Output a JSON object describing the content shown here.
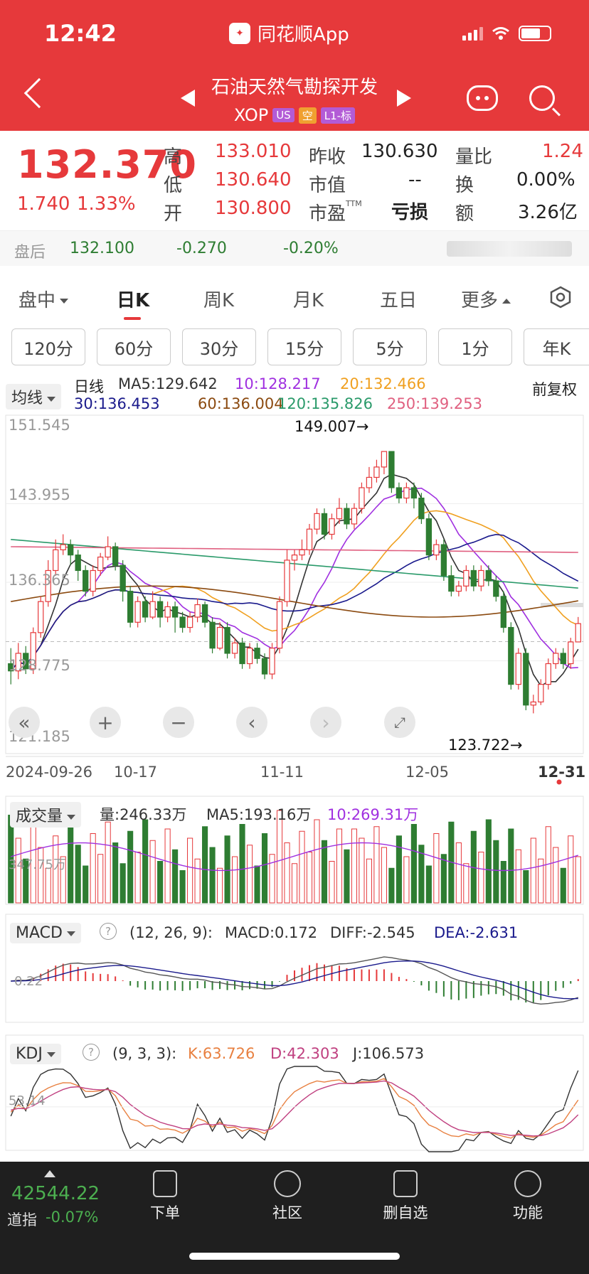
{
  "status_bar": {
    "time": "12:42",
    "app_name": "同花顺App"
  },
  "header": {
    "stock_name": "石油天然气勘探开发",
    "code": "XOP",
    "tags": [
      "US",
      "空",
      "L1-标"
    ]
  },
  "quote": {
    "price": "132.370",
    "change": "1.740",
    "change_pct": "1.33%",
    "high_label": "高",
    "high": "133.010",
    "low_label": "低",
    "low": "130.640",
    "open_label": "开",
    "open": "130.800",
    "prev_close_label": "昨收",
    "prev_close": "130.630",
    "market_cap_label": "市值",
    "market_cap": "--",
    "pe_label": "市盈",
    "pe_sup": "TTM",
    "pe": "亏损",
    "vol_ratio_label": "量比",
    "vol_ratio": "1.24",
    "turnover_label": "换",
    "turnover": "0.00%",
    "amount_label": "额",
    "amount": "3.26亿"
  },
  "after_hours": {
    "label": "盘后",
    "price": "132.100",
    "change": "-0.270",
    "change_pct": "-0.20%"
  },
  "tabs": [
    "盘中",
    "日K",
    "周K",
    "月K",
    "五日",
    "更多"
  ],
  "periods": [
    "120分",
    "60分",
    "30分",
    "15分",
    "5分",
    "1分",
    "年K"
  ],
  "kline": {
    "indicator": "均线",
    "period_label": "日线",
    "adjust": "前复权",
    "ma": [
      {
        "label": "MA5:129.642",
        "color": "#333333"
      },
      {
        "label": "10:128.217",
        "color": "#a030e0"
      },
      {
        "label": "20:132.466",
        "color": "#f0a020"
      },
      {
        "label": "30:136.453",
        "color": "#1a1a8c"
      },
      {
        "label": "60:136.004",
        "color": "#8b4a10"
      },
      {
        "label": "120:135.826",
        "color": "#2a9a6a"
      },
      {
        "label": "250:139.253",
        "color": "#e06080"
      }
    ],
    "y_labels": [
      "151.545",
      "143.955",
      "136.365",
      "128.775",
      "121.185"
    ],
    "x_labels": [
      "2024-09-26",
      "10-17",
      "11-11",
      "12-05",
      "12-31"
    ],
    "max_label": "149.007→",
    "min_label": "123.722→"
  },
  "chart_data": {
    "type": "candlestick",
    "y_range": [
      121.185,
      151.545
    ],
    "ohlc": [
      [
        128.5,
        127.8,
        130.0,
        126.5
      ],
      [
        127.8,
        129.5,
        130.5,
        127.0
      ],
      [
        129.5,
        128.0,
        130.2,
        127.5
      ],
      [
        128.0,
        131.5,
        132.0,
        127.5
      ],
      [
        131.5,
        134.5,
        135.0,
        131.0
      ],
      [
        134.5,
        137.5,
        138.5,
        134.0
      ],
      [
        137.5,
        139.5,
        140.5,
        137.0
      ],
      [
        139.5,
        140.0,
        141.0,
        139.0
      ],
      [
        140.0,
        139.0,
        140.5,
        138.0
      ],
      [
        139.0,
        137.5,
        139.5,
        136.5
      ],
      [
        137.5,
        135.5,
        138.0,
        135.0
      ],
      [
        135.5,
        137.5,
        138.0,
        135.0
      ],
      [
        137.5,
        138.8,
        139.2,
        137.0
      ],
      [
        138.8,
        139.8,
        140.8,
        138.5
      ],
      [
        139.8,
        138.0,
        140.2,
        137.5
      ],
      [
        138.0,
        135.5,
        138.5,
        134.5
      ],
      [
        135.5,
        132.5,
        136.0,
        132.0
      ],
      [
        132.5,
        134.5,
        135.0,
        132.0
      ],
      [
        134.5,
        133.0,
        135.0,
        132.5
      ],
      [
        133.0,
        134.5,
        135.5,
        132.8
      ],
      [
        134.5,
        133.0,
        135.0,
        132.0
      ],
      [
        133.0,
        134.0,
        134.5,
        132.5
      ],
      [
        134.0,
        133.0,
        134.5,
        131.5
      ],
      [
        133.0,
        132.0,
        133.5,
        131.5
      ],
      [
        132.0,
        133.0,
        133.5,
        131.5
      ],
      [
        133.0,
        134.2,
        134.8,
        132.5
      ],
      [
        134.2,
        132.5,
        134.5,
        132.0
      ],
      [
        132.5,
        130.0,
        133.0,
        129.5
      ],
      [
        130.0,
        132.0,
        132.5,
        129.8
      ],
      [
        132.0,
        129.5,
        132.5,
        129.0
      ],
      [
        129.5,
        130.5,
        131.0,
        129.0
      ],
      [
        130.5,
        128.5,
        131.0,
        128.0
      ],
      [
        128.5,
        130.0,
        130.5,
        128.0
      ],
      [
        130.0,
        129.0,
        130.5,
        128.5
      ],
      [
        129.0,
        127.5,
        129.5,
        127.0
      ],
      [
        127.5,
        130.0,
        130.5,
        127.0
      ],
      [
        130.0,
        134.5,
        135.0,
        129.5
      ],
      [
        134.5,
        138.5,
        139.5,
        134.0
      ],
      [
        138.5,
        139.0,
        139.5,
        137.5
      ],
      [
        139.0,
        139.5,
        140.5,
        138.5
      ],
      [
        139.5,
        141.5,
        142.0,
        139.0
      ],
      [
        141.5,
        143.0,
        143.5,
        141.0
      ],
      [
        143.0,
        141.0,
        143.5,
        140.5
      ],
      [
        141.0,
        142.5,
        143.0,
        140.5
      ],
      [
        142.5,
        143.5,
        144.5,
        142.0
      ],
      [
        143.5,
        142.0,
        144.0,
        141.5
      ],
      [
        142.0,
        143.5,
        144.0,
        141.5
      ],
      [
        143.5,
        145.5,
        146.0,
        143.0
      ],
      [
        145.5,
        146.5,
        147.5,
        145.0
      ],
      [
        146.5,
        147.5,
        148.2,
        146.0
      ],
      [
        147.5,
        149.0,
        149.0,
        146.8
      ],
      [
        149.0,
        145.5,
        149.0,
        145.0
      ],
      [
        145.5,
        144.5,
        146.0,
        144.0
      ],
      [
        144.5,
        145.5,
        146.0,
        144.0
      ],
      [
        145.5,
        144.5,
        146.0,
        143.5
      ],
      [
        144.5,
        142.5,
        145.0,
        142.0
      ],
      [
        142.5,
        139.0,
        143.0,
        138.5
      ],
      [
        139.0,
        140.0,
        140.5,
        138.5
      ],
      [
        140.0,
        137.0,
        140.5,
        136.5
      ],
      [
        137.0,
        135.5,
        138.0,
        135.0
      ],
      [
        135.5,
        136.0,
        136.5,
        135.0
      ],
      [
        136.0,
        137.5,
        138.0,
        135.5
      ],
      [
        137.5,
        136.0,
        138.0,
        135.5
      ],
      [
        136.0,
        137.5,
        138.0,
        135.5
      ],
      [
        137.5,
        136.5,
        138.0,
        136.0
      ],
      [
        136.5,
        135.0,
        137.0,
        134.5
      ],
      [
        135.0,
        132.0,
        135.5,
        131.5
      ],
      [
        132.0,
        126.5,
        132.5,
        126.0
      ],
      [
        126.5,
        129.5,
        130.0,
        126.0
      ],
      [
        129.5,
        124.5,
        130.0,
        124.0
      ],
      [
        124.5,
        124.8,
        125.5,
        123.7
      ],
      [
        124.8,
        126.5,
        127.0,
        124.5
      ],
      [
        126.5,
        128.5,
        129.0,
        126.0
      ],
      [
        128.5,
        129.5,
        130.0,
        128.0
      ],
      [
        129.5,
        128.5,
        130.0,
        128.0
      ],
      [
        128.5,
        130.6,
        131.0,
        128.0
      ],
      [
        130.6,
        132.37,
        133.01,
        130.64
      ]
    ]
  },
  "volume": {
    "indicator": "成交量",
    "vol": "量:246.33万",
    "ma5": "MA5:193.16万",
    "ma10": "10:269.31万",
    "axis_label": "347.75万"
  },
  "macd": {
    "indicator": "MACD",
    "params": "(12, 26, 9):",
    "macd": "MACD:0.172",
    "diff": "DIFF:-2.545",
    "dea": "DEA:-2.631",
    "axis_label": "0.22"
  },
  "kdj": {
    "indicator": "KDJ",
    "params": "(9, 3, 3):",
    "k": "K:63.726",
    "d": "D:42.303",
    "j": "J:106.573",
    "axis_label": "53.14"
  },
  "bottom_nav": {
    "index_value": "42544.22",
    "index_name": "道指",
    "index_change": "-0.07%",
    "items": [
      "下单",
      "社区",
      "删自选",
      "功能"
    ]
  },
  "colors": {
    "up": "#e6393b",
    "down": "#2e7d32",
    "brand": "#e6393b"
  }
}
